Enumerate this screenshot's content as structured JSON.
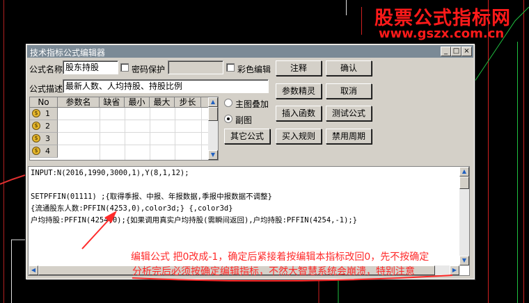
{
  "watermark": {
    "line1": "股票公式指标网",
    "line2": "www.gszx.com.cn"
  },
  "window": {
    "title": "技术指标公式编辑器"
  },
  "form": {
    "name_label": "公式名称",
    "name_value": "股东持股",
    "password_label": "密码保护",
    "color_edit_label": "彩色编辑",
    "desc_label": "公式描述",
    "desc_value": "最新人数、人均持股、持股比例"
  },
  "buttons": {
    "annotate": "注释",
    "ok": "确认",
    "param_wizard": "参数精灵",
    "cancel": "取消",
    "insert_func": "插入函数",
    "test_formula": "测试公式",
    "other_formula": "其它公式",
    "buy_rule": "买入规则",
    "disable_period": "禁用周期"
  },
  "radios": {
    "main_overlay": "主图叠加",
    "sub_chart": "副图"
  },
  "grid": {
    "headers": [
      "No",
      "参数名",
      "缺省",
      "最小",
      "最大",
      "步长"
    ],
    "rows": [
      "1",
      "2",
      "3",
      "4"
    ]
  },
  "code": {
    "line1": "INPUT:N(2016,1990,3000,1),Y(8,1,12);",
    "line2": "SETPFFIN(01111) ;{取得季报、中报、年报数据,季报中报数据不调整}",
    "line3": "{流通股东人数:PFFIN(4253,0),color3d;} {,color3d}",
    "line4": "户均持股:PFFIN(4254,0);{如果调用真实户均持股(需瞬间返回),户均持股:PFFIN(4254,-1);}"
  },
  "annotation": {
    "line1": "编辑公式 把0改成-1，确定后紧接着按编辑本指标改回0，先不按确定",
    "line2": "分析完后必须按确定编辑指标，不然大智慧系统会崩溃，特别注意"
  },
  "colors": {
    "annotation": "#ff2a2a",
    "titlebar": "#7b8a96",
    "dialog": "#d4d0c8"
  }
}
